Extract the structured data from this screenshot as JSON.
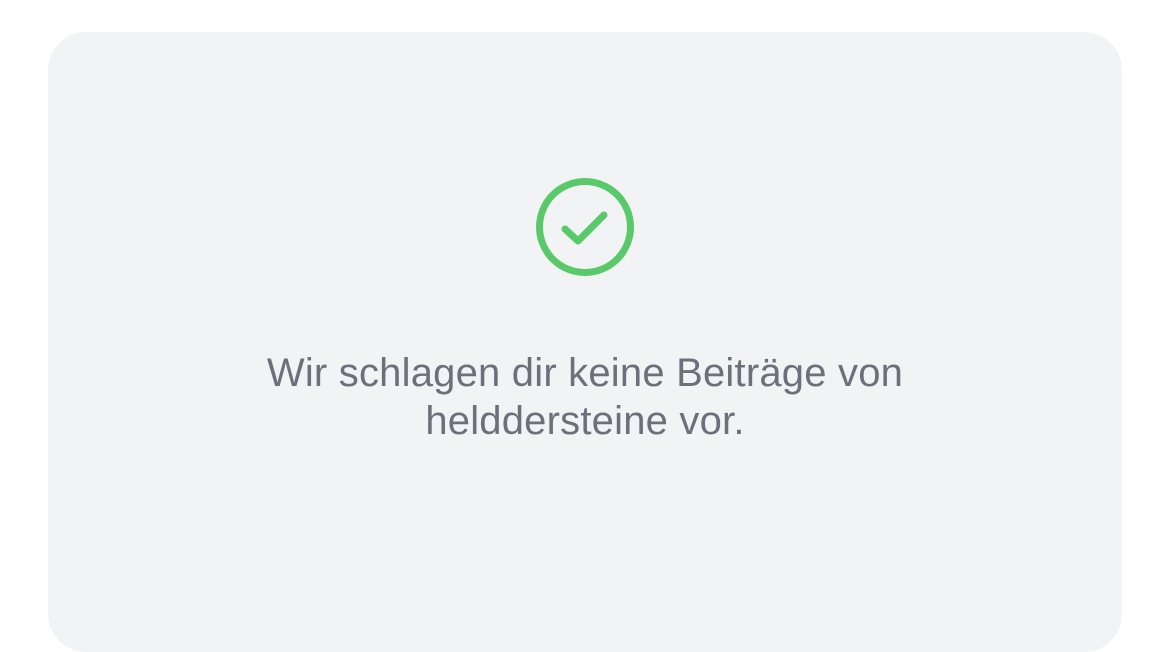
{
  "status": {
    "icon": "check-circle-icon",
    "color": "#5ac96a"
  },
  "message": {
    "line1": "Wir schlagen dir keine Beiträge von",
    "line2": "helddersteine vor."
  },
  "colors": {
    "card_background": "#f2f3f5",
    "text": "#6c707b"
  }
}
